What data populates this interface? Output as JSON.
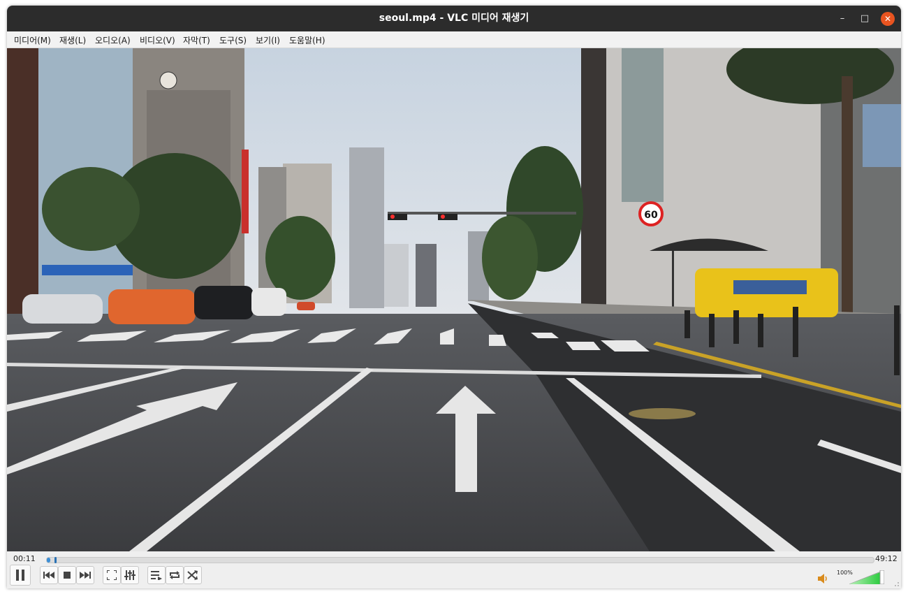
{
  "window": {
    "title": "seoul.mp4 - VLC 미디어 재생기",
    "minimize_glyph": "–",
    "maximize_glyph": "□",
    "close_glyph": "✕"
  },
  "menu": {
    "items": [
      {
        "label": "미디어(M)"
      },
      {
        "label": "재생(L)"
      },
      {
        "label": "오디오(A)"
      },
      {
        "label": "비디오(V)"
      },
      {
        "label": "자막(T)"
      },
      {
        "label": "도구(S)"
      },
      {
        "label": "보기(I)"
      },
      {
        "label": "도움말(H)"
      }
    ]
  },
  "video": {
    "content": "seoul street video frame",
    "speed_sign": "60"
  },
  "playback": {
    "elapsed": "00:11",
    "total": "49:12",
    "progress_fraction": 0.004
  },
  "volume": {
    "label": "100%",
    "level_fraction": 1.0
  },
  "icons": {
    "pause": "pause-icon",
    "previous": "skip-previous-icon",
    "stop": "stop-icon",
    "next": "skip-next-icon",
    "fullscreen": "fullscreen-icon",
    "extended": "equalizer-icon",
    "playlist": "playlist-icon",
    "loop": "loop-icon",
    "shuffle": "shuffle-icon",
    "speaker": "speaker-icon"
  },
  "colors": {
    "titlebar": "#2c2c2c",
    "close_button": "#e95420",
    "seek_fill": "#3d8fd6",
    "volume_fill": "#3cc43c"
  }
}
